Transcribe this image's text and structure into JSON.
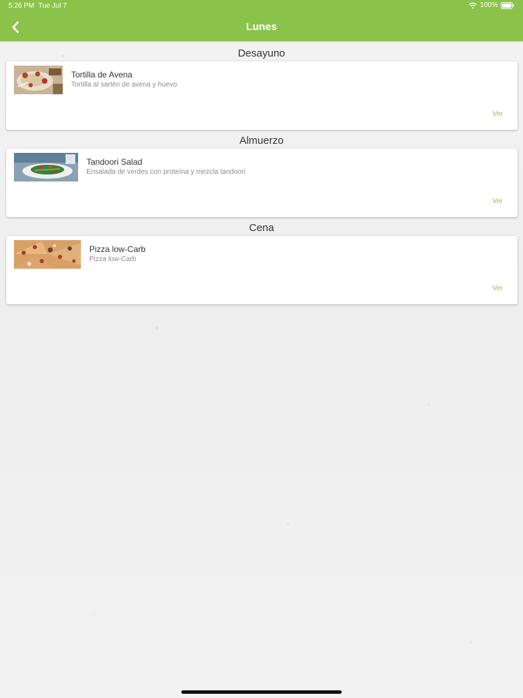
{
  "status_bar": {
    "time": "5:26 PM",
    "date": "Tue Jul 7",
    "battery": "100%",
    "icons": [
      "wifi-icon",
      "battery-icon"
    ]
  },
  "nav": {
    "title": "Lunes",
    "back_icon": "chevron-left-icon",
    "bar_color": "#8bc34a"
  },
  "meals": [
    {
      "section": "Desayuno",
      "name": "Tortilla de Avena",
      "description": "Tortilla al sartén de avena y huevo",
      "action": "Ver"
    },
    {
      "section": "Almuerzo",
      "name": "Tandoori Salad",
      "description": "Ensalada de verdes con proteína y mezcla tandoori",
      "action": "Ver"
    },
    {
      "section": "Cena",
      "name": "Pizza low-Carb",
      "description": "Pizza low-Carb",
      "action": "Ver"
    }
  ],
  "colors": {
    "accent": "#8bc34a",
    "background": "#f1f1f1",
    "card": "#ffffff"
  }
}
